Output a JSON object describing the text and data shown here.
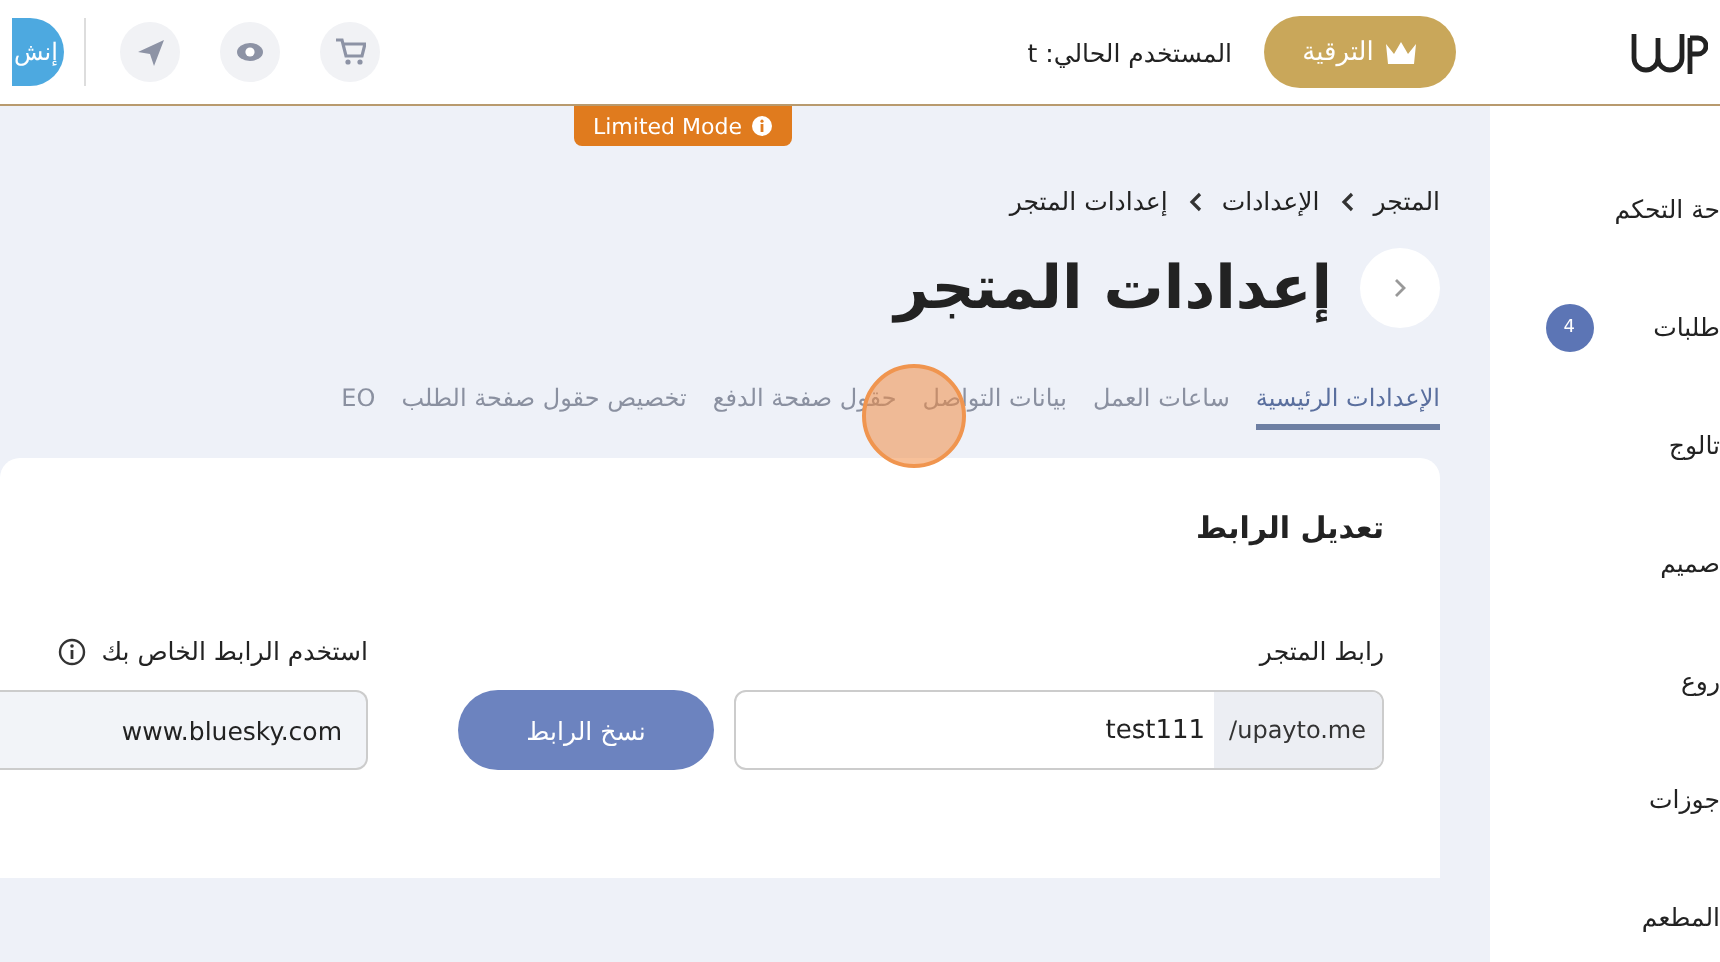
{
  "topbar": {
    "create_button": "إنش",
    "user_label": "المستخدم الحالي: t",
    "upgrade_button": "الترقية"
  },
  "limited_mode_badge": "Limited Mode",
  "sidebar": {
    "items": [
      {
        "label": "حة التحكم"
      },
      {
        "label": "طلبات",
        "badge": "4"
      },
      {
        "label": "تالوج"
      },
      {
        "label": "صميم"
      },
      {
        "label": "روع"
      },
      {
        "label": "جوزات"
      },
      {
        "label": "المطعم"
      }
    ]
  },
  "breadcrumb": [
    "المتجر",
    "الإعدادات",
    "إعدادات المتجر"
  ],
  "page_title": "إعدادات المتجر",
  "tabs": [
    {
      "label": "الإعدادات الرئيسية",
      "selected": true
    },
    {
      "label": "ساعات العمل",
      "selected": false
    },
    {
      "label": "بيانات التواصل",
      "selected": false
    },
    {
      "label": "حقول صفحة الدفع",
      "selected": false
    },
    {
      "label": "تخصيص حقول صفحة الطلب",
      "selected": false
    },
    {
      "label": "EO",
      "selected": false
    }
  ],
  "card": {
    "title": "تعديل الرابط",
    "store_link": {
      "label": "رابط المتجر",
      "prefix": "/upayto.me",
      "value": "test111"
    },
    "copy_button": "نسخ الرابط",
    "custom_link": {
      "label": "استخدم الرابط الخاص بك",
      "value": "www.bluesky.com"
    }
  }
}
